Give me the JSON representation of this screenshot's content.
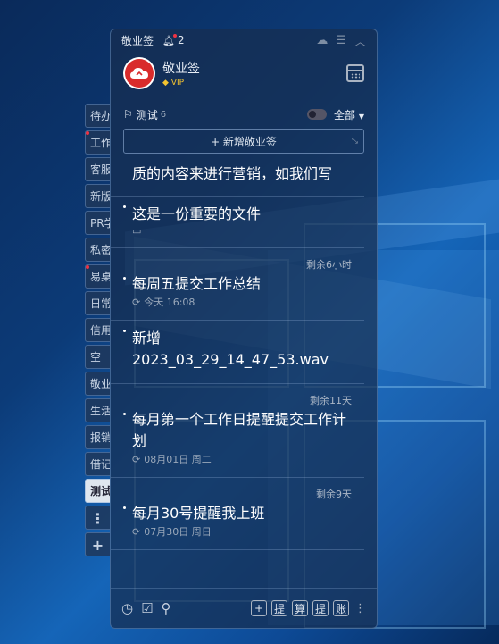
{
  "app": {
    "title": "敬业签",
    "notif_count": "2",
    "user_name": "敬业签",
    "vip": "VIP"
  },
  "side_tabs": [
    {
      "label": "待办",
      "dot": false
    },
    {
      "label": "工作",
      "dot": true
    },
    {
      "label": "客服",
      "dot": false
    },
    {
      "label": "新版",
      "dot": false
    },
    {
      "label": "PR学",
      "dot": false
    },
    {
      "label": "私密",
      "dot": false
    },
    {
      "label": "易桌",
      "dot": true
    },
    {
      "label": "日常",
      "dot": false
    },
    {
      "label": "信用",
      "dot": false
    },
    {
      "label": "空",
      "dot": false
    },
    {
      "label": "敬业",
      "dot": false
    },
    {
      "label": "生活",
      "dot": false
    },
    {
      "label": "报销",
      "dot": false
    },
    {
      "label": "借记",
      "dot": false
    },
    {
      "label": "测试",
      "dot": false,
      "active": true
    }
  ],
  "side_more": "⋮",
  "side_add": "+",
  "filter": {
    "group_name": "测试",
    "group_count": "6",
    "scope": "全部"
  },
  "new_button": {
    "label": "+ 新增敬业签",
    "expand_icon": "⤡"
  },
  "notes": [
    {
      "title": "质的内容来进行营销，如我们写",
      "remain": "",
      "meta": "",
      "meta_icon": ""
    },
    {
      "title": "这是一份重要的文件",
      "remain": "",
      "meta": "",
      "meta_icon": "attachment"
    },
    {
      "title": "每周五提交工作总结",
      "remain": "剩余6小时",
      "meta": "今天 16:08",
      "meta_icon": "repeat"
    },
    {
      "title": "新增\n2023_03_29_14_47_53.wav",
      "remain": "",
      "meta": "",
      "meta_icon": ""
    },
    {
      "title": "每月第一个工作日提醒提交工作计划",
      "remain": "剩余11天",
      "meta": "08月01日 周二",
      "meta_icon": "repeat"
    },
    {
      "title": "每月30号提醒我上班",
      "remain": "剩余9天",
      "meta": "07月30日 周日",
      "meta_icon": "repeat"
    }
  ],
  "footer": {
    "btn_add": "+",
    "btn_ti": "提",
    "btn_suan": "算",
    "btn_ti2": "提",
    "btn_zhang": "账"
  }
}
